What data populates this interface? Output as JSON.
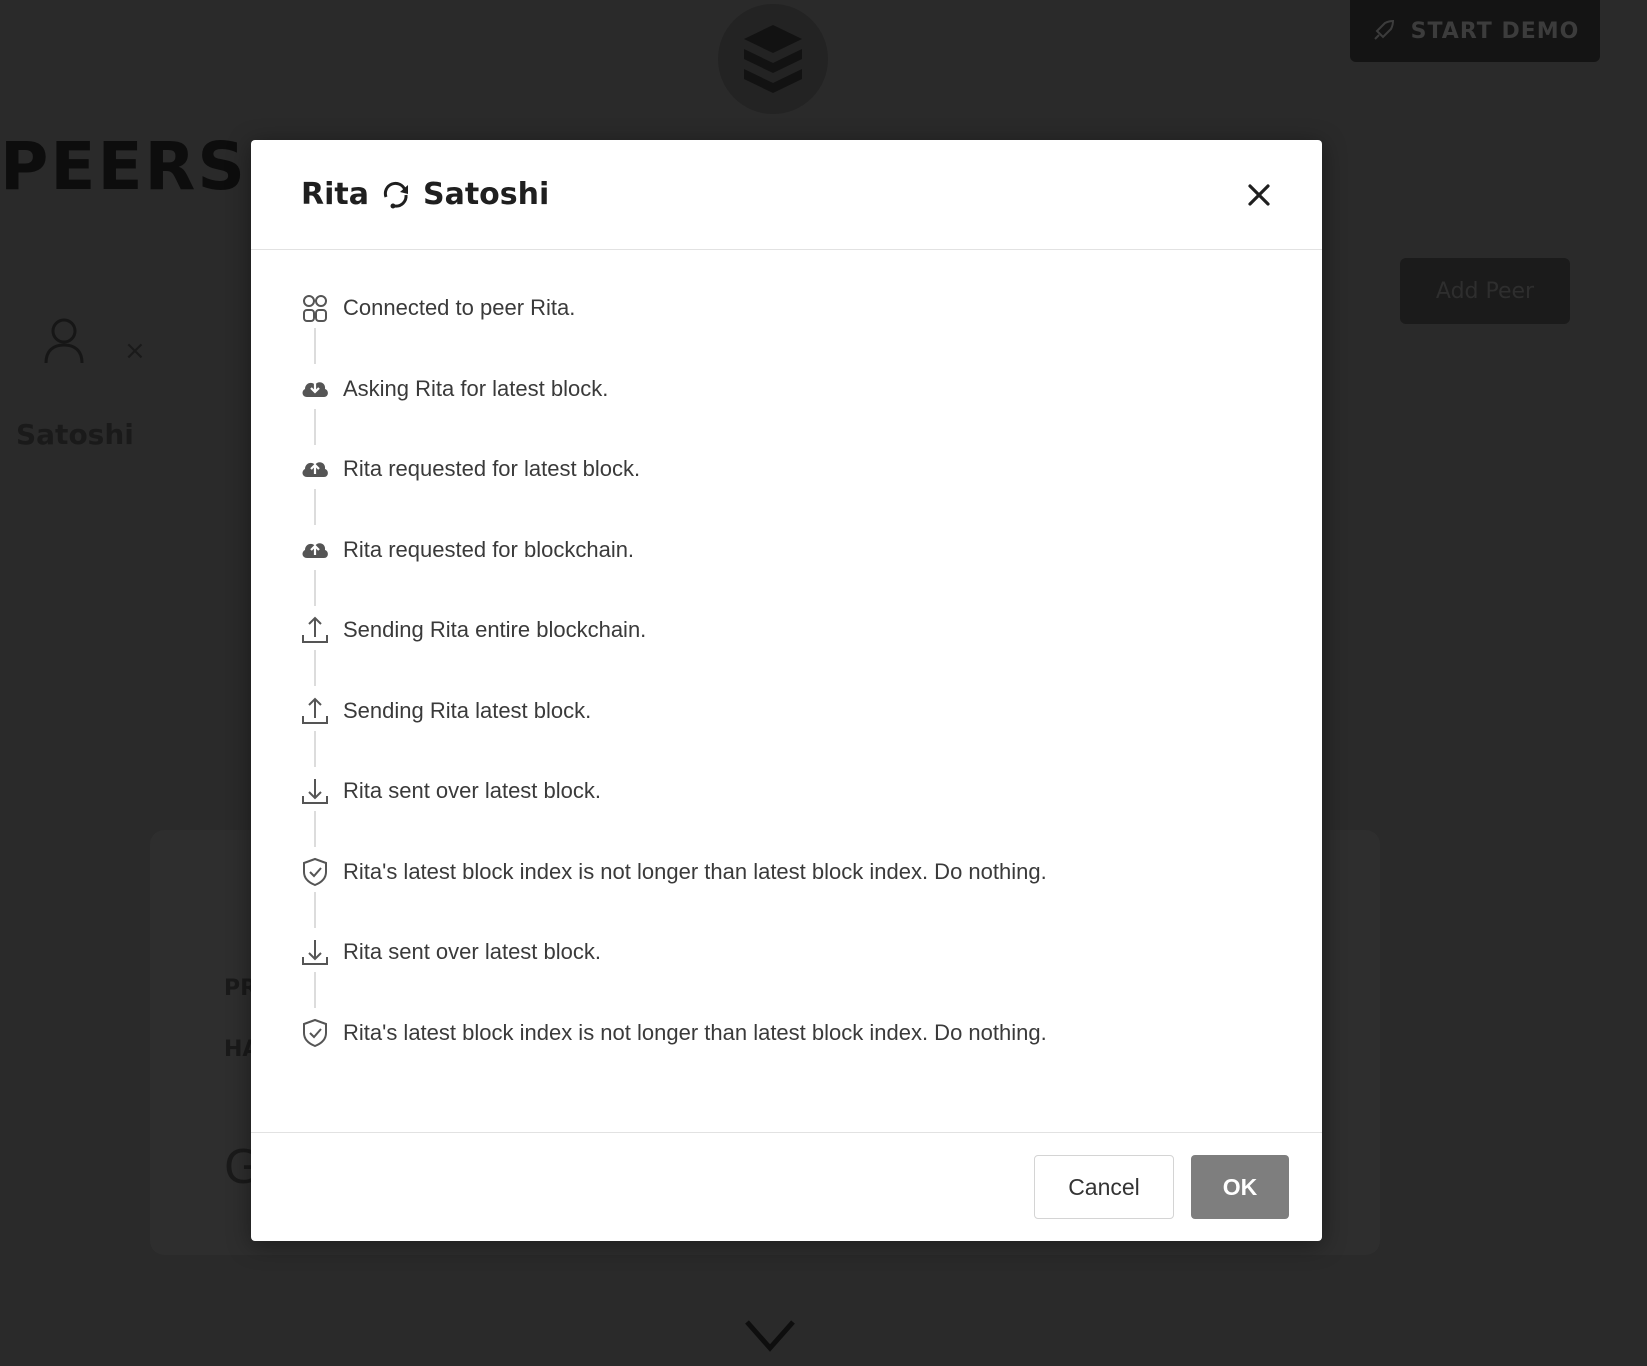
{
  "background": {
    "start_demo_label": "START DEMO",
    "section_title": "PEERS",
    "peer_name": "Satoshi",
    "peer_remove_glyph": "×",
    "add_peer_label": "Add Peer",
    "card_label_1": "PR",
    "card_label_2": "HA",
    "card_label_3": "G"
  },
  "modal": {
    "title_left": "Rita",
    "title_right": "Satoshi",
    "title_icon": "sync-icon",
    "events": [
      {
        "icon": "peers-icon",
        "text": "Connected to peer Rita."
      },
      {
        "icon": "cloud-download-icon",
        "text": "Asking Rita for latest block."
      },
      {
        "icon": "cloud-upload-icon",
        "text": "Rita requested for latest block."
      },
      {
        "icon": "cloud-upload-icon",
        "text": "Rita requested for blockchain."
      },
      {
        "icon": "upload-icon",
        "text": "Sending Rita entire blockchain."
      },
      {
        "icon": "upload-icon",
        "text": "Sending Rita latest block."
      },
      {
        "icon": "download-icon",
        "text": "Rita sent over latest block."
      },
      {
        "icon": "shield-check-icon",
        "text": "Rita's latest block index is not longer than latest block index. Do nothing."
      },
      {
        "icon": "download-icon",
        "text": "Rita sent over latest block."
      },
      {
        "icon": "shield-check-icon",
        "text": "Rita's latest block index is not longer than latest block index. Do nothing."
      }
    ],
    "cancel_label": "Cancel",
    "ok_label": "OK"
  },
  "colors": {
    "overlay": "#262626",
    "modal_bg": "#ffffff",
    "ok_button": "#7e7e7e",
    "text": "#3a3a3a"
  }
}
